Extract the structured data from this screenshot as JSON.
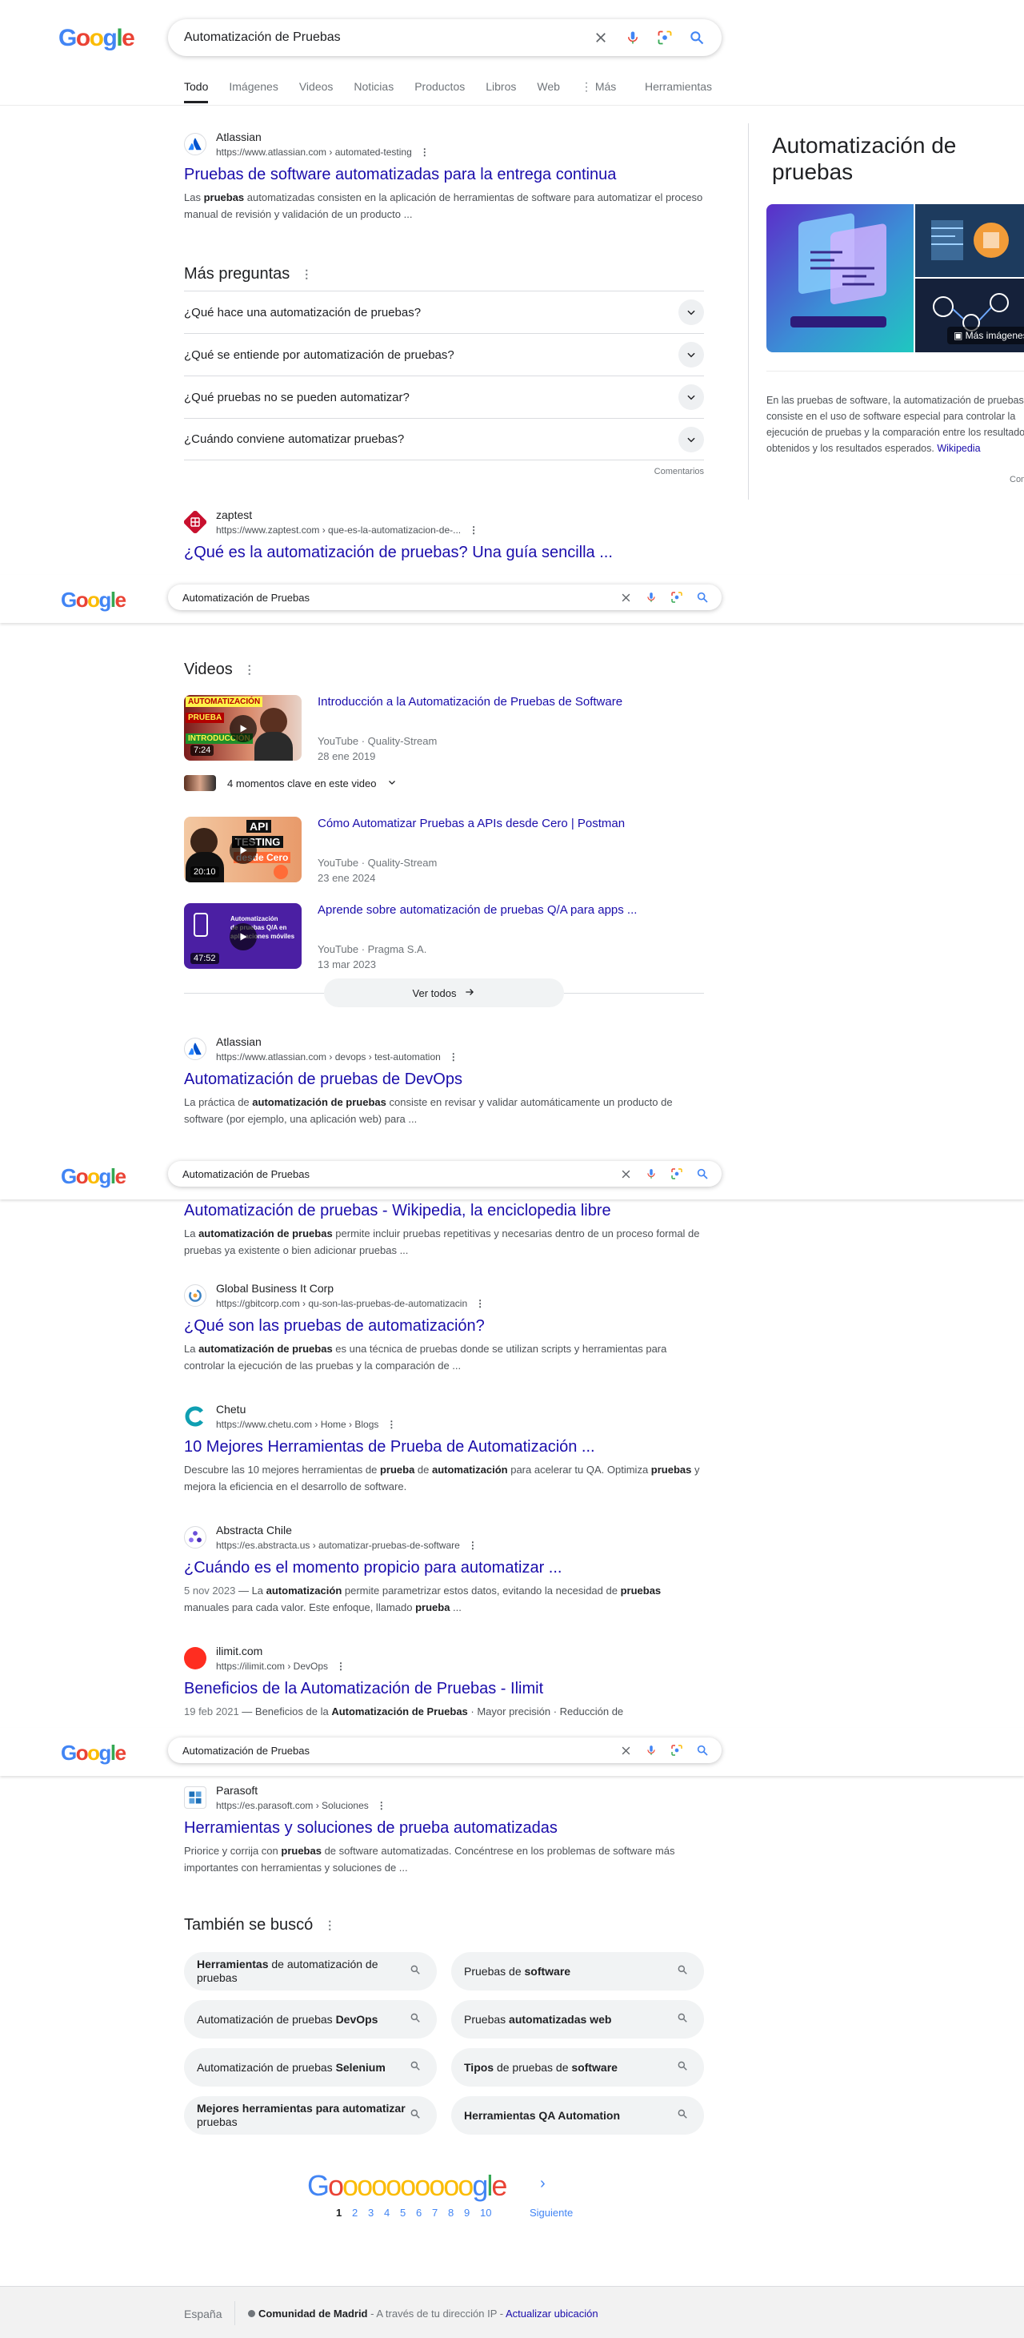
{
  "query": "Automatización de Pruebas",
  "tabs": [
    "Todo",
    "Imágenes",
    "Videos",
    "Noticias",
    "Productos",
    "Libros",
    "Web",
    "Más"
  ],
  "tools_label": "Herramientas",
  "results": {
    "r1": {
      "site": "Atlassian",
      "url": "https://www.atlassian.com › automated-testing",
      "title": "Pruebas de software automatizadas para la entrega continua",
      "snip_a": "Las ",
      "snip_b": "pruebas",
      "snip_c": " automatizadas consisten en la aplicación de herramientas de software para automatizar el proceso manual de revisión y validación de un producto ..."
    },
    "r2": {
      "site": "zaptest",
      "url": "https://www.zaptest.com › que-es-la-automatizacion-de-...",
      "title": "¿Qué es la automatización de pruebas? Una guía sencilla ..."
    },
    "r3": {
      "site": "Atlassian",
      "url": "https://www.atlassian.com › devops › test-automation",
      "title": "Automatización de pruebas de DevOps",
      "snip_a": "La práctica de ",
      "snip_b": "automatización de pruebas",
      "snip_c": " consiste en revisar y validar automáticamente un producto de software (por ejemplo, una aplicación web) para ..."
    },
    "r4": {
      "title": "Automatización de pruebas - Wikipedia, la enciclopedia libre",
      "snip_a": " La ",
      "snip_b": "automatización de pruebas",
      "snip_c": " permite incluir pruebas repetitivas y necesarias dentro de un proceso formal de pruebas ya existente o bien adicionar pruebas ..."
    },
    "r5": {
      "site": "Global Business It Corp",
      "url": "https://gbitcorp.com › qu-son-las-pruebas-de-automatizacin",
      "title": "¿Qué son las pruebas de automatización?",
      "snip_a": "La ",
      "snip_b": "automatización de pruebas",
      "snip_c": " es una técnica de pruebas donde se utilizan scripts y herramientas para controlar la ejecución de las pruebas y la comparación de ..."
    },
    "r6": {
      "site": "Chetu",
      "url": "https://www.chetu.com › Home › Blogs",
      "title": "10 Mejores Herramientas de Prueba de Automatización ...",
      "snip_a": "Descubre las 10 mejores herramientas de ",
      "snip_b": "prueba",
      "snip_c": " de ",
      "snip_d": "automatización",
      "snip_e": " para acelerar tu QA. Optimiza ",
      "snip_f": "pruebas",
      "snip_g": " y mejora la eficiencia en el desarrollo de software."
    },
    "r7": {
      "site": "Abstracta Chile",
      "url": "https://es.abstracta.us › automatizar-pruebas-de-software",
      "title": "¿Cuándo es el momento propicio para automatizar ...",
      "date": "5 nov 2023",
      "snip_a": " — La ",
      "snip_b": "automatización",
      "snip_c": " permite parametrizar estos datos, evitando la necesidad de ",
      "snip_d": "pruebas",
      "snip_e": " manuales para cada valor. Este enfoque, llamado ",
      "snip_f": "prueba",
      "snip_g": " ..."
    },
    "r8": {
      "site": "ilimit.com",
      "url": "https://ilimit.com › DevOps",
      "title": "Beneficios de la Automatización de Pruebas - Ilimit",
      "date": "19 feb 2021",
      "snip_a": " — Beneficios de la ",
      "snip_b": "Automatización de Pruebas",
      "snip_c": " · Mayor precisión · Reducción de"
    },
    "r9": {
      "site": "Parasoft",
      "url": "https://es.parasoft.com › Soluciones",
      "title": "Herramientas y soluciones de prueba automatizadas",
      "snip_a": "Priorice y corrija con ",
      "snip_b": "pruebas",
      "snip_c": " de software automatizadas. Concéntrese en los problemas de software más importantes con herramientas y soluciones de ..."
    }
  },
  "paa": {
    "title": "Más preguntas",
    "questions": [
      "¿Qué hace una automatización de pruebas?",
      "¿Qué se entiende por automatización de pruebas?",
      "¿Qué pruebas no se pueden automatizar?",
      "¿Cuándo conviene automatizar pruebas?"
    ],
    "feedback": "Comentarios"
  },
  "videos": {
    "title": "Videos",
    "items": [
      {
        "title": "Introducción a la Automatización de Pruebas de Software",
        "source": "YouTube · Quality-Stream",
        "date": "28 ene 2019",
        "duration": "7:24",
        "thumb_text_1": "AUTOMATIZACIÓN",
        "thumb_text_2": "PRUEBA",
        "thumb_text_3": "INTRODUCCIÓN"
      },
      {
        "title": "Cómo Automatizar Pruebas a APIs desde Cero | Postman",
        "source": "YouTube · Quality-Stream",
        "date": "23 ene 2024",
        "duration": "20:10",
        "thumb_text_1": "API",
        "thumb_text_2": "TESTING",
        "thumb_text_3": "desde Cero"
      },
      {
        "title": "Aprende sobre automatización de pruebas Q/A para apps ...",
        "source": "YouTube · Pragma S.A.",
        "date": "13 mar 2023",
        "duration": "47:52",
        "thumb_text_1": "Automatización",
        "thumb_text_2": "de pruebas Q/A en",
        "thumb_text_3": "aplicaciones móviles"
      }
    ],
    "key_moments": "4 momentos clave en este video",
    "view_all": "Ver todos"
  },
  "related": {
    "title": "También se buscó",
    "items": [
      {
        "b1": "Herramientas",
        "n1": " de automatización de pruebas",
        "b2": "",
        "n2": ""
      },
      {
        "b1": "",
        "n1": "Pruebas de ",
        "b2": "software",
        "n2": ""
      },
      {
        "b1": "",
        "n1": "Automatización de pruebas ",
        "b2": "DevOps",
        "n2": ""
      },
      {
        "b1": "",
        "n1": "Pruebas ",
        "b2": "automatizadas web",
        "n2": ""
      },
      {
        "b1": "",
        "n1": "Automatización de pruebas ",
        "b2": "Selenium",
        "n2": ""
      },
      {
        "b1": "Tipos",
        "n1": " de pruebas de ",
        "b2": "software",
        "n2": ""
      },
      {
        "b1": "Mejores herramientas para automatizar",
        "n1": " pruebas",
        "b2": "",
        "n2": ""
      },
      {
        "b1": "Herramientas QA Automation",
        "n1": "",
        "b2": "",
        "n2": ""
      }
    ]
  },
  "pagination": {
    "pages": [
      "1",
      "2",
      "3",
      "4",
      "5",
      "6",
      "7",
      "8",
      "9",
      "10"
    ],
    "next": "Siguiente"
  },
  "knowledge_panel": {
    "title": "Automatización de pruebas",
    "more_images": "Más imágenes",
    "description": "En las pruebas de software, la automatización de pruebas consiste en el uso de software especial para controlar la ejecución de pruebas y la comparación entre los resultados obtenidos y los resultados esperados.",
    "source": "Wikipedia",
    "feedback": "Comentarios"
  },
  "footer": {
    "country": "España",
    "location": "Comunidad de Madrid",
    "via": " - A través de tu dirección IP - ",
    "update": "Actualizar ubicación"
  },
  "colors": {
    "link": "#1a0dab",
    "blue": "#4285f4",
    "red": "#ea4335",
    "yellow": "#fbbc05",
    "green": "#34a853"
  }
}
